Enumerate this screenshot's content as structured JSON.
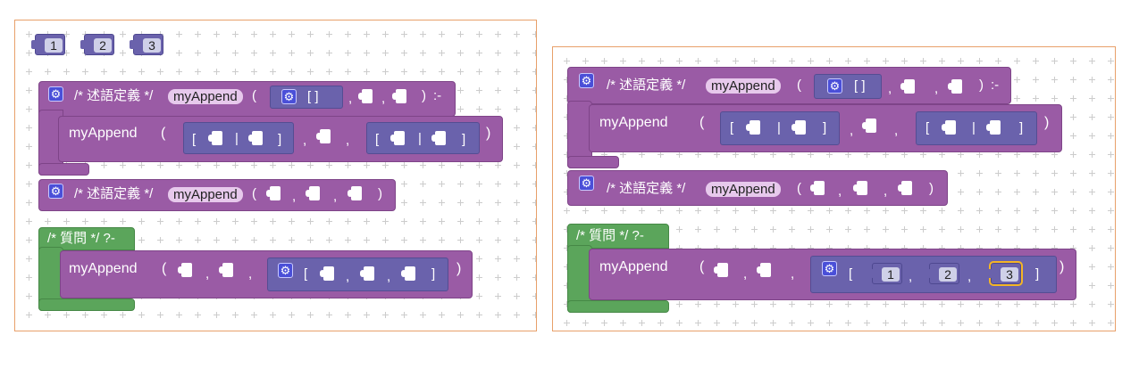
{
  "left": {
    "numbers": [
      "1",
      "2",
      "3"
    ],
    "def1": {
      "comment": "/* 述語定義 */",
      "name": "myAppend",
      "open": "(",
      "empty_list": "[ ]",
      "comma": ",",
      "close": ")",
      "rule": ":-",
      "body_label": "myAppend",
      "list_open": "[",
      "bar": "|",
      "list_close": "]"
    },
    "def2": {
      "comment": "/* 述語定義 */",
      "name": "myAppend",
      "open": "(",
      "comma": ",",
      "close": ")"
    },
    "query": {
      "header": "/* 質問 */ ?-",
      "label": "myAppend",
      "open": "(",
      "comma": ",",
      "close": ")",
      "list_open": "[",
      "list_close": "]"
    }
  },
  "right": {
    "def1": {
      "comment": "/* 述語定義 */",
      "name": "myAppend",
      "open": "(",
      "empty_list": "[ ]",
      "comma": ",",
      "close": ")",
      "rule": ":-",
      "body_label": "myAppend",
      "list_open": "[",
      "bar": "|",
      "list_close": "]"
    },
    "def2": {
      "comment": "/* 述語定義 */",
      "name": "myAppend",
      "open": "(",
      "comma": ",",
      "close": ")"
    },
    "query": {
      "header": "/* 質問 */ ?-",
      "label": "myAppend",
      "open": "(",
      "comma": ",",
      "close": ")",
      "list_open": "[",
      "list_close": "]",
      "values": [
        "1",
        "2",
        "3"
      ]
    }
  },
  "colors": {
    "predicate": "#9a5ba5",
    "query": "#5ba55b",
    "list": "#6a62ac",
    "highlight": "#f4b526",
    "border": "#e8a06a"
  }
}
